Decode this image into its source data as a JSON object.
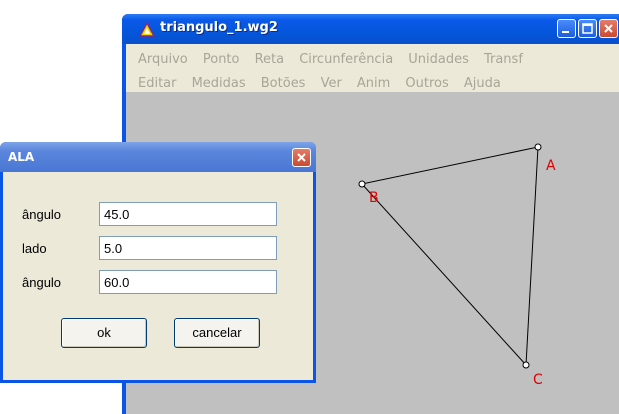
{
  "main_window": {
    "title": "triangulo_1.wg2",
    "menu_row_1": [
      "Arquivo",
      "Ponto",
      "Reta",
      "Circunferência",
      "Unidades",
      "Transf"
    ],
    "menu_row_2": [
      "Editar",
      "Medidas",
      "Botões",
      "Ver",
      "Anim",
      "Outros",
      "Ajuda"
    ]
  },
  "canvas": {
    "points": [
      {
        "label": "A"
      },
      {
        "label": "B"
      },
      {
        "label": "C"
      }
    ]
  },
  "dialog": {
    "title": "ALA",
    "fields": [
      {
        "label": "ângulo",
        "value": "45.0"
      },
      {
        "label": "lado",
        "value": "5.0"
      },
      {
        "label": "ângulo",
        "value": "60.0"
      }
    ],
    "ok_label": "ok",
    "cancel_label": "cancelar"
  },
  "colors": {
    "titlebar": "#0a54e6",
    "point_label": "#e00000",
    "canvas_bg": "#c0c0c0"
  }
}
